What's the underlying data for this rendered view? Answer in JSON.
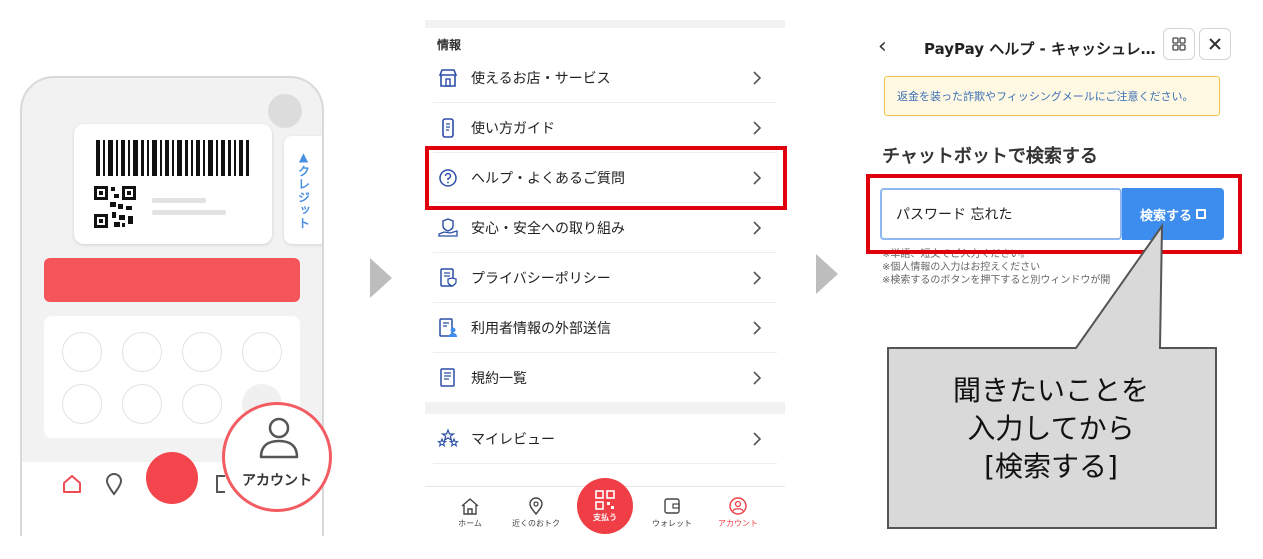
{
  "panel1": {
    "credit_label": "▲クレジット",
    "account_label": "アカウント"
  },
  "panel2": {
    "section_label": "情報",
    "items": [
      {
        "label": "使えるお店・サービス",
        "icon": "store-icon"
      },
      {
        "label": "使い方ガイド",
        "icon": "phone-guide-icon"
      },
      {
        "label": "ヘルプ・よくあるご質問",
        "icon": "question-circle-icon"
      },
      {
        "label": "安心・安全への取り組み",
        "icon": "shield-hand-icon"
      },
      {
        "label": "プライバシーポリシー",
        "icon": "privacy-doc-icon"
      },
      {
        "label": "利用者情報の外部送信",
        "icon": "user-doc-icon"
      },
      {
        "label": "規約一覧",
        "icon": "terms-doc-icon"
      }
    ],
    "review_item": {
      "label": "マイレビュー",
      "icon": "stars-icon"
    },
    "tabs": [
      {
        "label": "ホーム",
        "icon": "home-icon"
      },
      {
        "label": "近くのおトク",
        "icon": "location-icon"
      },
      {
        "label": "支払う",
        "icon": "qr-icon"
      },
      {
        "label": "ウォレット",
        "icon": "wallet-icon"
      },
      {
        "label": "アカウント",
        "icon": "account-icon",
        "active": true
      }
    ],
    "active_color": "#ef3e45"
  },
  "panel3": {
    "title": "PayPay ヘルプ - キャッシュレ…",
    "notice": "返金を装った詐欺やフィッシングメールにご注意ください。",
    "chat_heading": "チャットボットで検索する",
    "search_value": "パスワード 忘れた",
    "search_button": "検索する",
    "notes": [
      "※単語、短文でご入力ください。",
      "※個人情報の入力はお控えください",
      "※検索するのボタンを押下すると別ウィンドウが開"
    ],
    "accent_color": "#3c8dee"
  },
  "callout": {
    "lines": [
      "聞きたいことを",
      "入力してから",
      "[検索する]"
    ]
  },
  "highlight_color": "#e0000b"
}
